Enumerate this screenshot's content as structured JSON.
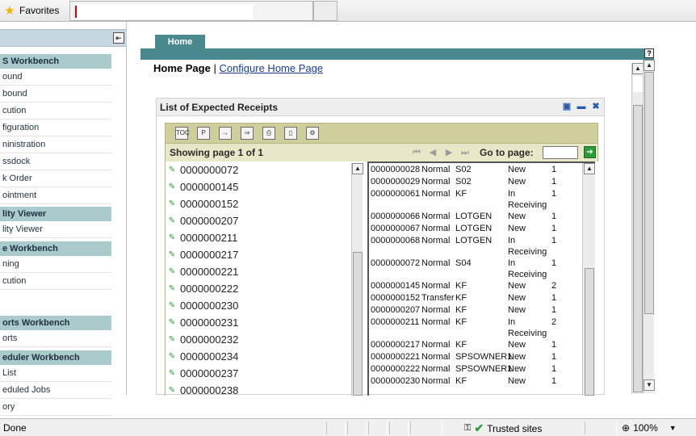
{
  "browser": {
    "favorites_label": "Favorites",
    "address_value": ""
  },
  "sidebar": {
    "groups": [
      {
        "label": "S Workbench",
        "items": [
          "ound",
          "bound",
          "cution",
          "figuration",
          "ninistration",
          "ssdock",
          "k Order",
          "ointment"
        ]
      },
      {
        "label": "lity Viewer",
        "items": [
          "lity Viewer"
        ]
      },
      {
        "label": "e Workbench",
        "items": [
          "ning",
          "cution"
        ]
      },
      {
        "label": "orts Workbench",
        "items": [
          "orts"
        ]
      },
      {
        "label": "eduler Workbench",
        "items": [
          "List",
          "eduled Jobs",
          "ory"
        ]
      }
    ]
  },
  "main": {
    "tab_home": "Home",
    "help_icon": "?",
    "breadcrumb_home": "Home Page",
    "breadcrumb_sep": "|",
    "breadcrumb_link": "Configure Home Page"
  },
  "portlet": {
    "title": "List of Expected Receipts",
    "icons": [
      "save-icon",
      "minimize-icon",
      "close-icon"
    ],
    "toolbar_icons": [
      "toc-icon",
      "pdf-icon",
      "export-icon",
      "export-all-icon",
      "print-icon",
      "document-icon",
      "settings-icon"
    ],
    "pager": {
      "showing_text": "Showing page  1  of  1",
      "goto_label": "Go to page:",
      "goto_value": ""
    },
    "left_items": [
      "0000000072",
      "0000000145",
      "0000000152",
      "0000000207",
      "0000000211",
      "0000000217",
      "0000000221",
      "0000000222",
      "0000000230",
      "0000000231",
      "0000000232",
      "0000000234",
      "0000000237",
      "0000000238"
    ],
    "rows": [
      {
        "id": "0000000028",
        "type": "Normal",
        "owner": "S02",
        "status": "New",
        "status2": "",
        "qty": "1"
      },
      {
        "id": "0000000029",
        "type": "Normal",
        "owner": "S02",
        "status": "New",
        "status2": "",
        "qty": "1"
      },
      {
        "id": "0000000061",
        "type": "Normal",
        "owner": "KF",
        "status": "In",
        "status2": "Receiving",
        "qty": "1"
      },
      {
        "id": "0000000066",
        "type": "Normal",
        "owner": "LOTGEN",
        "status": "New",
        "status2": "",
        "qty": "1"
      },
      {
        "id": "0000000067",
        "type": "Normal",
        "owner": "LOTGEN",
        "status": "New",
        "status2": "",
        "qty": "1"
      },
      {
        "id": "0000000068",
        "type": "Normal",
        "owner": "LOTGEN",
        "status": "In",
        "status2": "Receiving",
        "qty": "1"
      },
      {
        "id": "0000000072",
        "type": "Normal",
        "owner": "S04",
        "status": "In",
        "status2": "Receiving",
        "qty": "1"
      },
      {
        "id": "0000000145",
        "type": "Normal",
        "owner": "KF",
        "status": "New",
        "status2": "",
        "qty": "2"
      },
      {
        "id": "0000000152",
        "type": "Transfer",
        "owner": "KF",
        "status": "New",
        "status2": "",
        "qty": "1"
      },
      {
        "id": "0000000207",
        "type": "Normal",
        "owner": "KF",
        "status": "New",
        "status2": "",
        "qty": "1"
      },
      {
        "id": "0000000211",
        "type": "Normal",
        "owner": "KF",
        "status": "In",
        "status2": "Receiving",
        "qty": "2"
      },
      {
        "id": "0000000217",
        "type": "Normal",
        "owner": "KF",
        "status": "New",
        "status2": "",
        "qty": "1"
      },
      {
        "id": "0000000221",
        "type": "Normal",
        "owner": "SPSOWNER1",
        "status": "New",
        "status2": "",
        "qty": "1"
      },
      {
        "id": "0000000222",
        "type": "Normal",
        "owner": "SPSOWNER1",
        "status": "New",
        "status2": "",
        "qty": "1"
      },
      {
        "id": "0000000230",
        "type": "Normal",
        "owner": "KF",
        "status": "New",
        "status2": "",
        "qty": "1"
      }
    ]
  },
  "status": {
    "text": "Done",
    "zone": "Trusted sites",
    "zoom": "100%"
  }
}
